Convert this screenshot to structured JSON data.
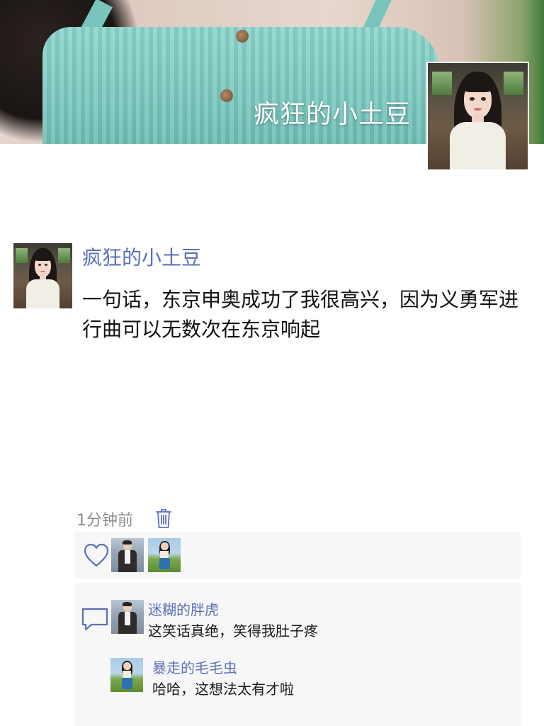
{
  "cover": {
    "title": "疯狂的小土豆"
  },
  "post": {
    "author": "疯狂的小土豆",
    "text": "一句话，东京申奥成功了我很高兴，因为义勇军进行曲可以无数次在东京响起",
    "time": "1分钟前"
  },
  "icons": {
    "delete": "trash-icon",
    "like": "heart-icon",
    "comment": "comment-bubble-icon"
  },
  "comments": [
    {
      "name": "迷糊的胖虎",
      "text": "这笑话真绝，笑得我肚子疼"
    },
    {
      "name": "暴走的毛毛虫",
      "text": "哈哈，这想法太有才啦"
    }
  ],
  "colors": {
    "link": "#5b6fb8",
    "panel": "#f7f7f7",
    "meta": "#8a8a8a"
  }
}
